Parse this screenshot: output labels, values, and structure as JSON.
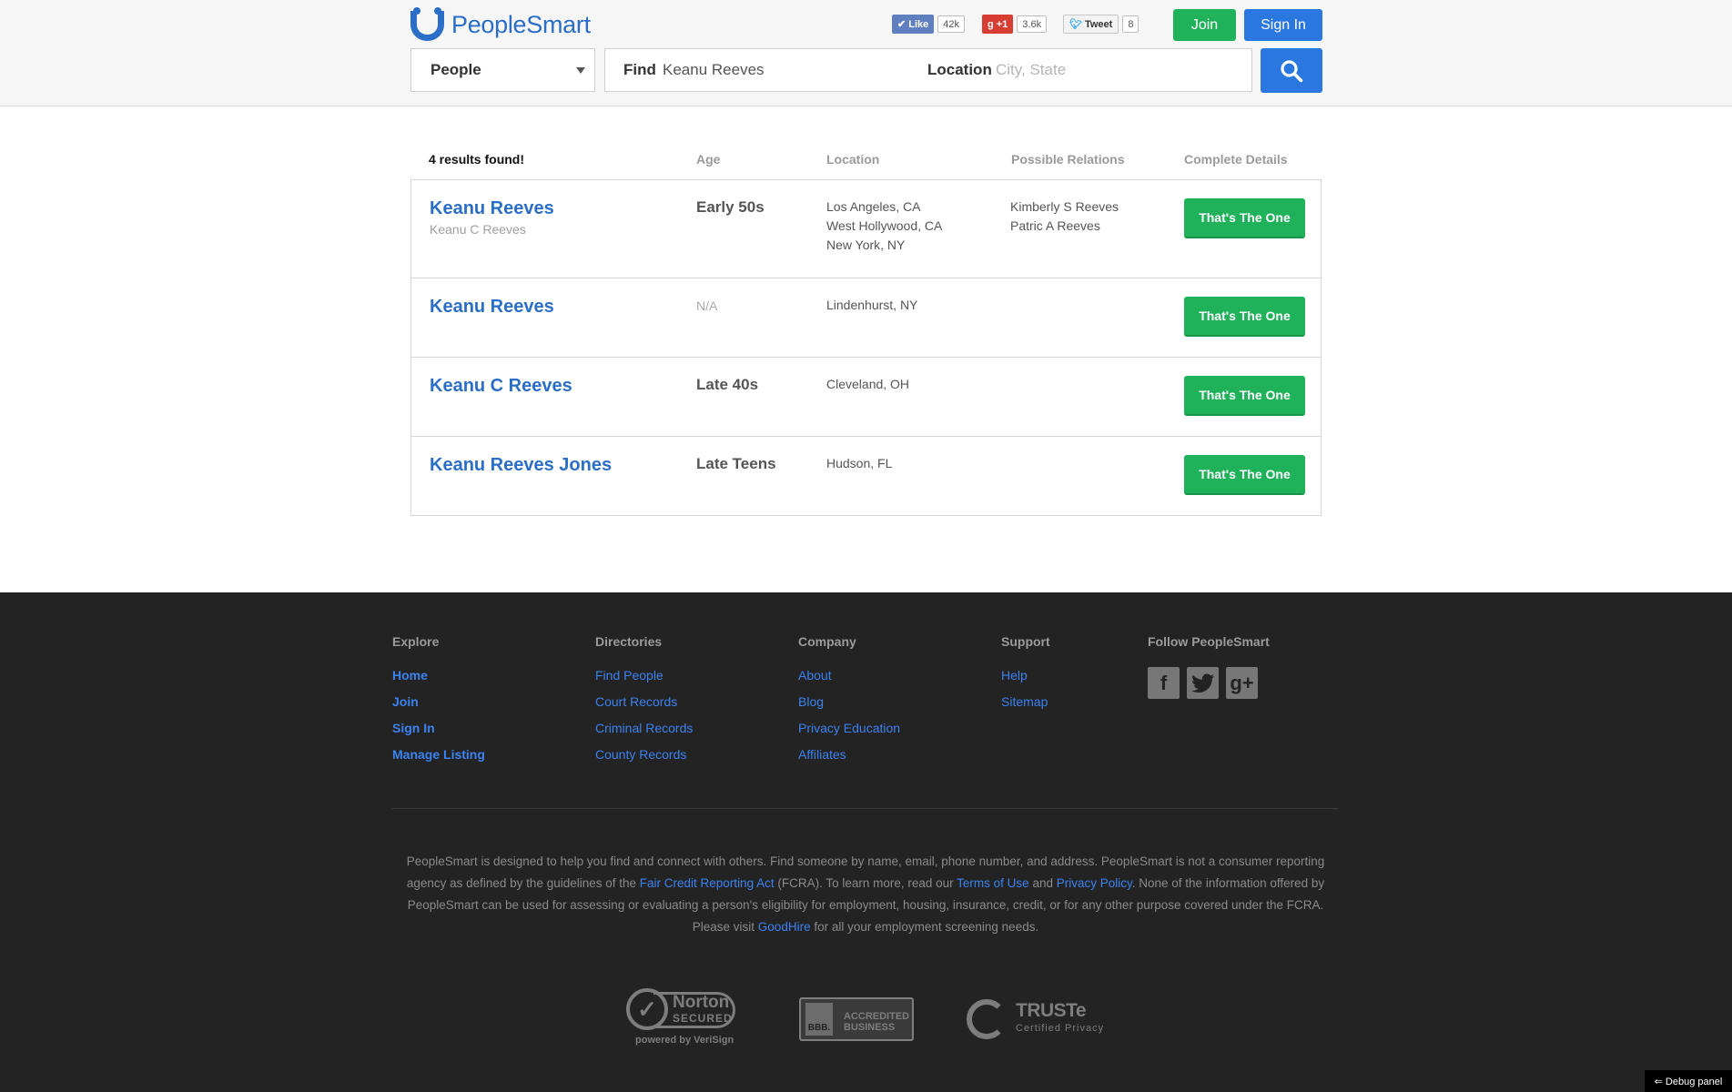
{
  "header": {
    "logo_text": "PeopleSmart",
    "social": {
      "facebook": {
        "label": "Like",
        "count": "42k"
      },
      "gplus": {
        "label": "+1",
        "count": "3.6k"
      },
      "twitter": {
        "label": "Tweet",
        "count": "8"
      }
    },
    "join_label": "Join",
    "signin_label": "Sign In",
    "search": {
      "type_selected": "People",
      "find_label": "Find",
      "find_value": "Keanu Reeves",
      "location_label": "Location",
      "location_placeholder": "City, State"
    }
  },
  "results": {
    "count_text": "4 results found!",
    "columns": {
      "age": "Age",
      "location": "Location",
      "relations": "Possible Relations",
      "details": "Complete Details"
    },
    "button_label": "That's The One",
    "rows": [
      {
        "name": "Keanu Reeves",
        "aka": "Keanu C Reeves",
        "age": "Early 50s",
        "locations": [
          "Los Angeles, CA",
          "West Hollywood, CA",
          "New York, NY"
        ],
        "relations": [
          "Kimberly S Reeves",
          "Patric A Reeves"
        ]
      },
      {
        "name": "Keanu Reeves",
        "aka": "",
        "age": "N/A",
        "locations": [
          "Lindenhurst, NY"
        ],
        "relations": []
      },
      {
        "name": "Keanu C Reeves",
        "aka": "",
        "age": "Late 40s",
        "locations": [
          "Cleveland, OH"
        ],
        "relations": []
      },
      {
        "name": "Keanu Reeves Jones",
        "aka": "",
        "age": "Late Teens",
        "locations": [
          "Hudson, FL"
        ],
        "relations": []
      }
    ]
  },
  "footer": {
    "explore": {
      "title": "Explore",
      "links": [
        "Home",
        "Join",
        "Sign In",
        "Manage Listing"
      ]
    },
    "directories": {
      "title": "Directories",
      "links": [
        "Find People",
        "Court Records",
        "Criminal Records",
        "County Records"
      ]
    },
    "company": {
      "title": "Company",
      "links": [
        "About",
        "Blog",
        "Privacy Education",
        "Affiliates"
      ]
    },
    "support": {
      "title": "Support",
      "links": [
        "Help",
        "Sitemap"
      ]
    },
    "follow": {
      "title": "Follow PeopleSmart",
      "icons": [
        "facebook-icon",
        "twitter-icon",
        "google-plus-icon"
      ]
    },
    "disclaimer": {
      "p1": "PeopleSmart is designed to help you find and connect with others. Find someone by name, email, phone number, and address. PeopleSmart is not a consumer reporting agency as defined by the guidelines of the ",
      "link1": "Fair Credit Reporting Act",
      "p2": " (FCRA). To learn more, read our ",
      "link2": "Terms of Use",
      "p3": " and ",
      "link3": "Privacy Policy",
      "p4": ". None of the information offered by PeopleSmart can be used for assessing or evaluating a person's eligibility for employment, housing, insurance, credit, or for any other purpose covered under the FCRA. Please visit ",
      "link4": "GoodHire",
      "p5": " for all your employment screening needs."
    },
    "badges": {
      "norton_title": "Norton",
      "norton_sub": "SECURED",
      "norton_powered": "powered by VeriSign",
      "bbb_logo": "BBB.",
      "bbb_line1": "ACCREDITED",
      "bbb_line2": "BUSINESS",
      "truste_title": "TRUSTe",
      "truste_sub": "Certified Privacy"
    }
  },
  "debug_label": "⇐ Debug panel",
  "colors": {
    "brand_blue": "#2a6ec7",
    "green": "#1fb25a",
    "action_blue": "#2a77e0",
    "footer_bg": "#232323"
  }
}
